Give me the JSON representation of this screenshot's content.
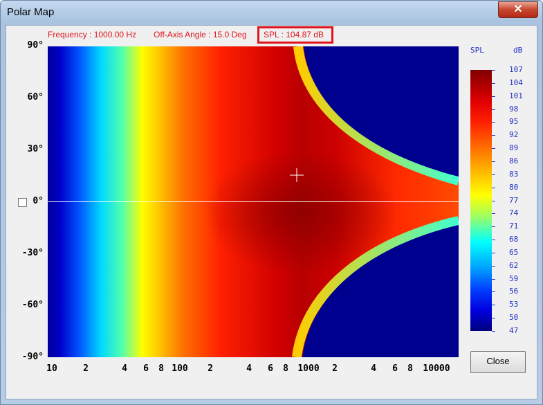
{
  "window": {
    "title": "Polar Map",
    "close_glyph": "✕"
  },
  "info": {
    "frequency": "Frequency : 1000.00 Hz",
    "angle": "Off-Axis Angle : 15.0 Deg",
    "spl": "SPL : 104.87 dB"
  },
  "y_ticks": [
    "90°",
    "60°",
    "30°",
    "0°",
    "-30°",
    "-60°",
    "-90°"
  ],
  "x_ticks": [
    "10",
    "2",
    "4",
    "6",
    "8",
    "100",
    "2",
    "4",
    "6",
    "8",
    "1000",
    "2",
    "4",
    "6",
    "8",
    "10000"
  ],
  "colorbar": {
    "title": "SPL",
    "unit": "dB",
    "labels": [
      "107",
      "104",
      "101",
      "98",
      "95",
      "92",
      "89",
      "86",
      "83",
      "80",
      "77",
      "74",
      "71",
      "68",
      "65",
      "62",
      "59",
      "56",
      "53",
      "50",
      "47"
    ]
  },
  "buttons": {
    "close": "Close"
  },
  "chart_data": {
    "type": "heatmap",
    "x_axis": {
      "scale": "log",
      "range": [
        10,
        20000
      ],
      "unit": "Hz"
    },
    "y_axis": {
      "range": [
        -90,
        90
      ],
      "unit": "deg"
    },
    "z_range": [
      47,
      107
    ],
    "cursor": {
      "frequency": 1000.0,
      "angle": 15.0,
      "spl": 104.87
    },
    "colormap": "jet"
  }
}
